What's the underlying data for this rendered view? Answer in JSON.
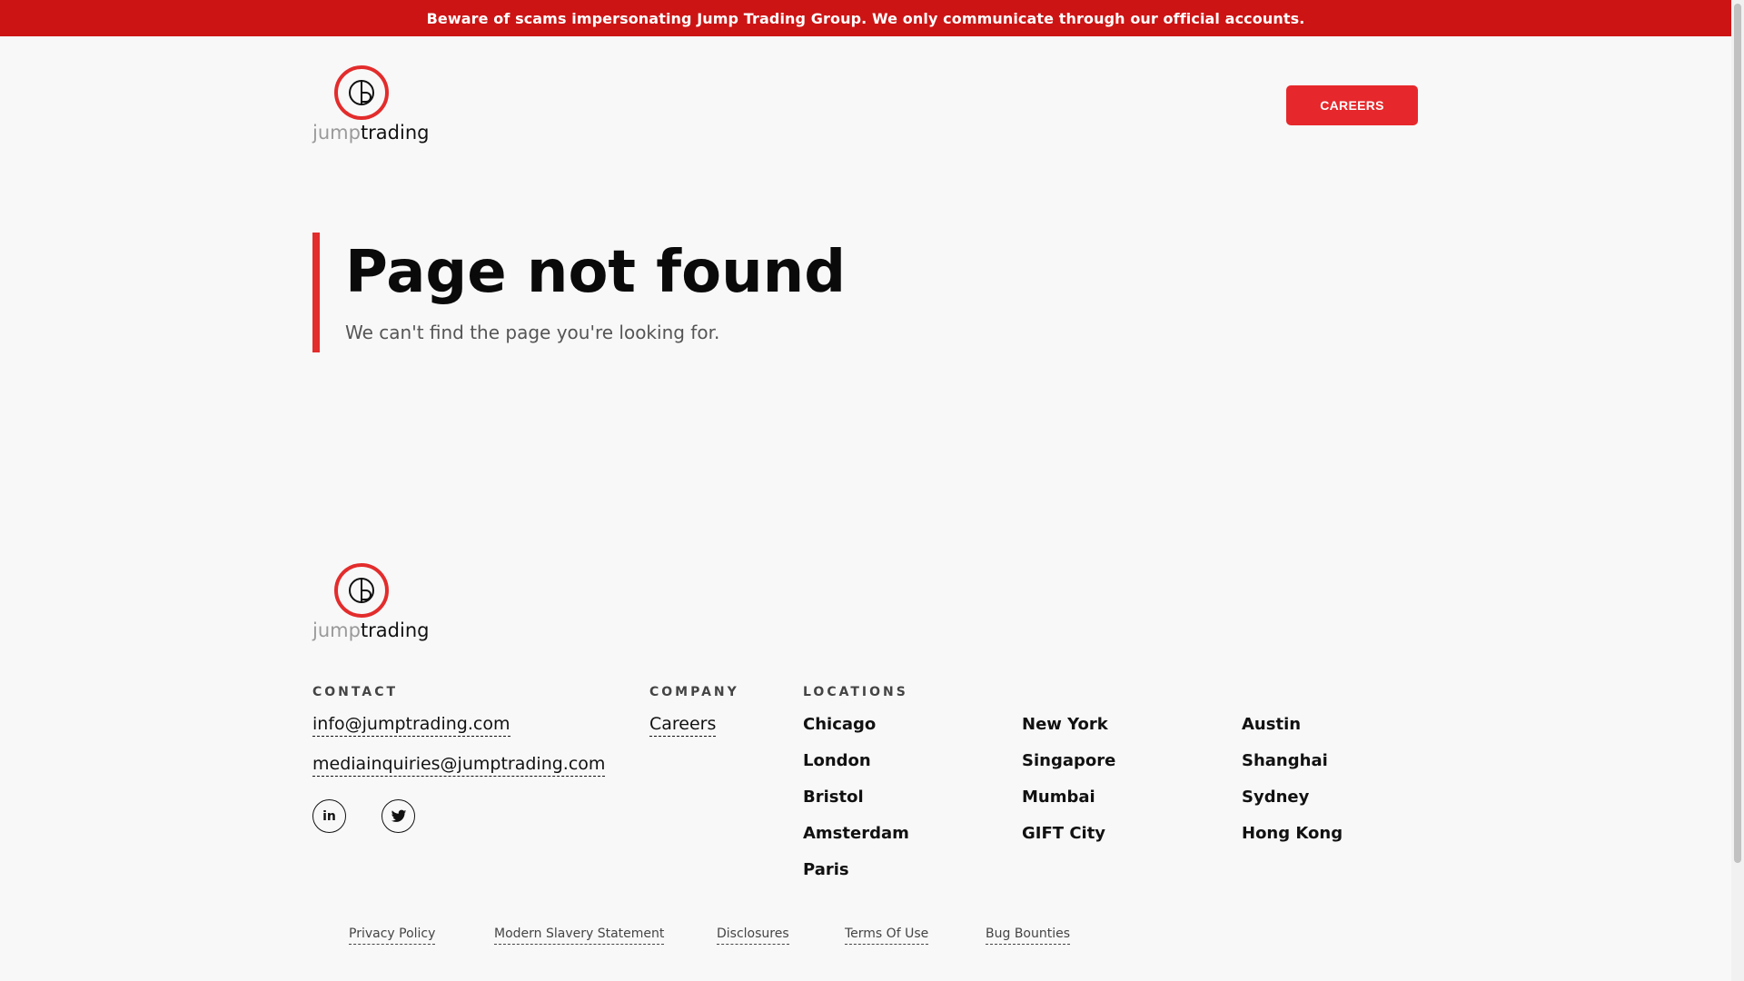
{
  "banner": {
    "text": "Beware of scams impersonating Jump Trading Group. We only communicate through our official accounts."
  },
  "header": {
    "logo": {
      "word_light": "jump",
      "word_dark": "trading"
    },
    "careers_label": "CAREERS"
  },
  "hero": {
    "title": "Page not found",
    "subtitle": "We can't find the page you're looking for."
  },
  "footer": {
    "logo": {
      "word_light": "jump",
      "word_dark": "trading"
    },
    "contact": {
      "heading": "CONTACT",
      "links": [
        "info@jumptrading.com",
        "mediainquiries@jumptrading.com"
      ],
      "social": [
        {
          "icon": "linkedin-icon",
          "glyph": "in"
        },
        {
          "icon": "twitter-icon",
          "glyph": ""
        }
      ]
    },
    "company": {
      "heading": "COMPANY",
      "links": [
        "Careers"
      ]
    },
    "locations": {
      "heading": "LOCATIONS",
      "col1": [
        "Chicago",
        "London",
        "Bristol",
        "Amsterdam",
        "Paris"
      ],
      "col2": [
        "New York",
        "Singapore",
        "Mumbai",
        "GIFT City"
      ],
      "col3": [
        "Austin",
        "Shanghai",
        "Sydney",
        "Hong Kong"
      ]
    },
    "legal": [
      "Privacy Policy",
      "Modern Slavery Statement",
      "Disclosures",
      "Terms Of Use",
      "Bug Bounties"
    ]
  },
  "colors": {
    "brand_red": "#e32c2c",
    "banner_red": "#cc1414"
  }
}
